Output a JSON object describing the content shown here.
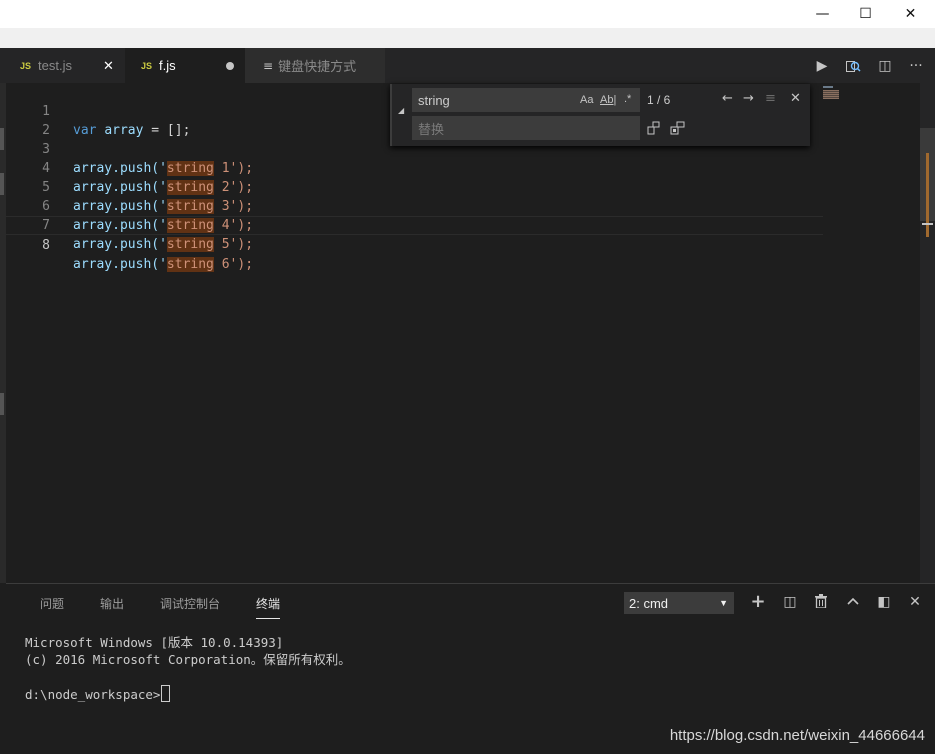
{
  "window": {
    "minimize": "—",
    "maximize": "☐",
    "close": "✕"
  },
  "tabs": [
    {
      "badge": "JS",
      "label": "test.js",
      "close": "✕"
    },
    {
      "badge": "JS",
      "label": "f.js",
      "dirty": "●"
    },
    {
      "icon": "≡",
      "label": "键盘快捷方式"
    }
  ],
  "toolbar": {
    "run": "▶",
    "split": "◫",
    "more": "···"
  },
  "editor": {
    "lines": [
      {
        "n": "1",
        "pre": "",
        "kw": "var",
        "sp": " ",
        "id": "array",
        "rest": " = [];"
      },
      {
        "n": "2"
      },
      {
        "n": "3",
        "a": "array.push('",
        "m": "string",
        "b": " 1');"
      },
      {
        "n": "4",
        "a": "array.push('",
        "m": "string",
        "b": " 2');"
      },
      {
        "n": "5",
        "a": "array.push('",
        "m": "string",
        "b": " 3');"
      },
      {
        "n": "6",
        "a": "array.push('",
        "m": "string",
        "b": " 4');"
      },
      {
        "n": "7",
        "a": "array.push('",
        "m": "string",
        "b": " 5');"
      },
      {
        "n": "8",
        "a": "array.push('",
        "m": "string",
        "b": " 6');"
      }
    ]
  },
  "find": {
    "query": "string",
    "replace_placeholder": "替换",
    "match_case": "Aa",
    "whole_word": "Ab|",
    "regex": ".*",
    "count": "1 / 6",
    "prev": "←",
    "next": "→",
    "selection": "≡",
    "close": "✕"
  },
  "panel": {
    "tabs": [
      "问题",
      "输出",
      "调试控制台",
      "终端"
    ],
    "terminal_select": "2: cmd",
    "select_arrow": "▼",
    "icons": {
      "add": "+",
      "split": "◫",
      "trash": "🗑",
      "up": "︿",
      "layout": "◧",
      "close": "✕"
    }
  },
  "terminal": {
    "line1": "Microsoft Windows [版本 10.0.14393]",
    "line2": "(c) 2016 Microsoft Corporation。保留所有权利。",
    "prompt": "d:\\node_workspace>"
  },
  "watermark": "https://blog.csdn.net/weixin_44666644"
}
